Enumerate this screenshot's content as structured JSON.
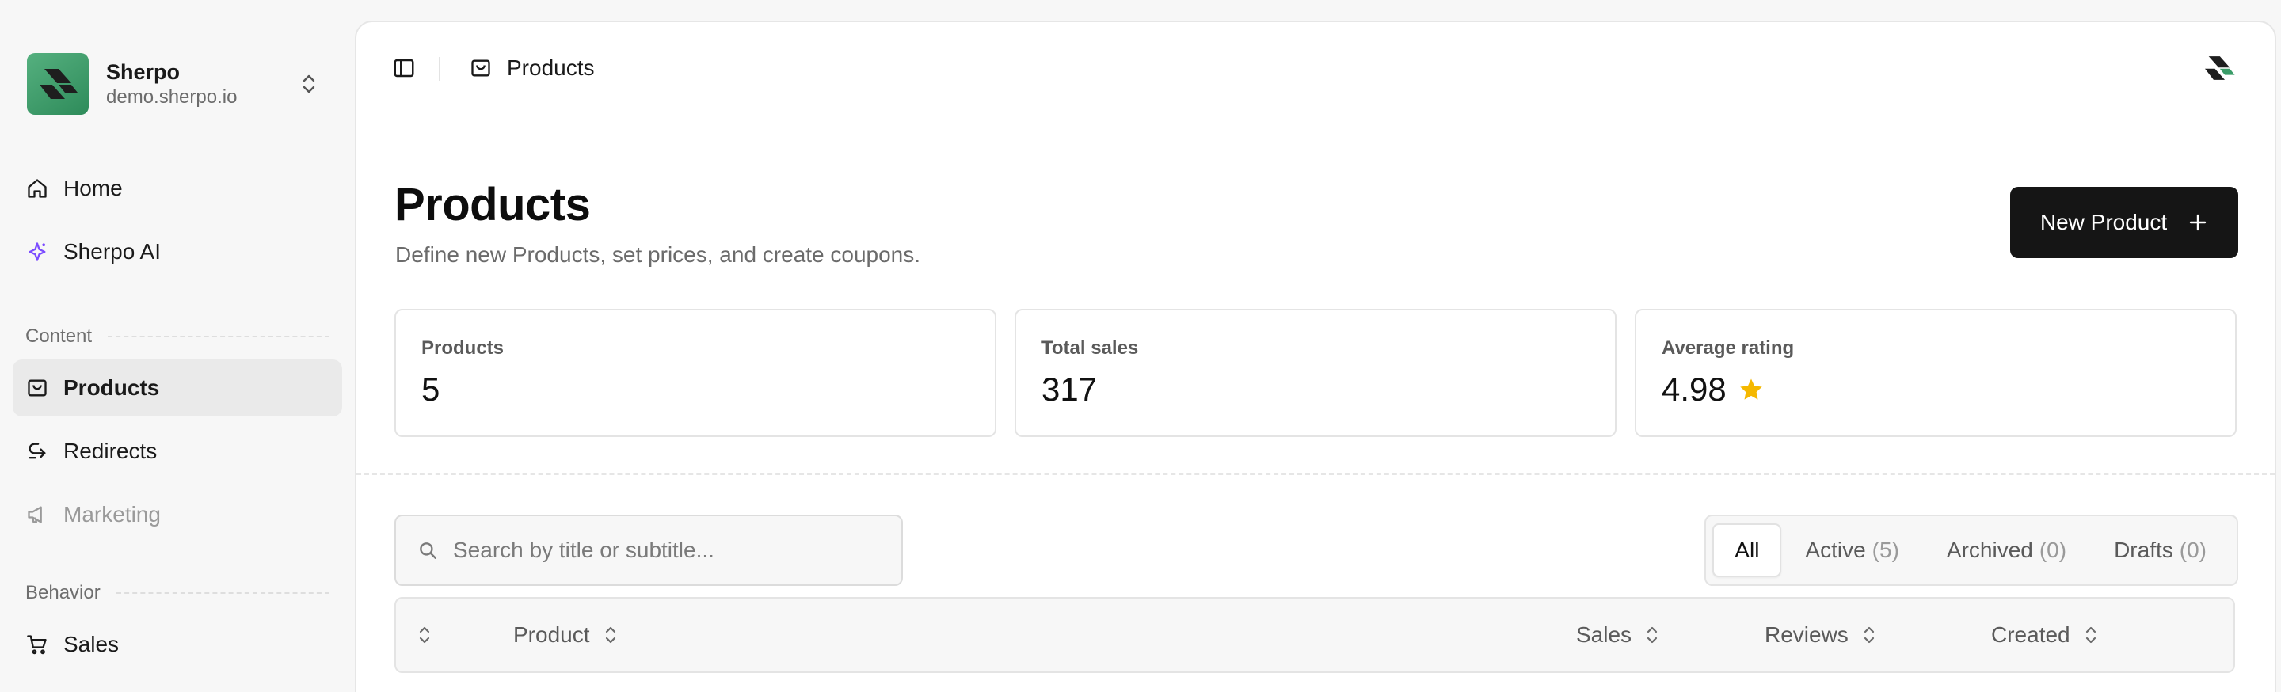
{
  "workspace": {
    "name": "Sherpo",
    "domain": "demo.sherpo.io"
  },
  "sidebar": {
    "items": [
      {
        "label": "Home",
        "icon": "home-icon"
      },
      {
        "label": "Sherpo AI",
        "icon": "sparkle-icon"
      }
    ],
    "sections": [
      {
        "label": "Content",
        "items": [
          {
            "label": "Products",
            "icon": "product-icon",
            "active": true
          },
          {
            "label": "Redirects",
            "icon": "redirect-icon"
          },
          {
            "label": "Marketing",
            "icon": "megaphone-icon",
            "disabled": true
          }
        ]
      },
      {
        "label": "Behavior",
        "items": [
          {
            "label": "Sales",
            "icon": "cart-icon"
          }
        ]
      }
    ]
  },
  "topbar": {
    "breadcrumb": "Products"
  },
  "page": {
    "title": "Products",
    "subtitle": "Define new Products, set prices, and create coupons.",
    "new_button": "New Product"
  },
  "stats": [
    {
      "label": "Products",
      "value": "5"
    },
    {
      "label": "Total sales",
      "value": "317"
    },
    {
      "label": "Average rating",
      "value": "4.98"
    }
  ],
  "search": {
    "placeholder": "Search by title or subtitle...",
    "value": ""
  },
  "filters": [
    {
      "label": "All",
      "count": ""
    },
    {
      "label": "Active",
      "count": "(5)"
    },
    {
      "label": "Archived",
      "count": "(0)"
    },
    {
      "label": "Drafts",
      "count": "(0)"
    }
  ],
  "table": {
    "columns": [
      "Product",
      "Sales",
      "Reviews",
      "Created"
    ]
  },
  "colors": {
    "brand": "#3a9c68",
    "accent": "#151515",
    "star": "#f5b800",
    "ai": "#7c4dff"
  }
}
